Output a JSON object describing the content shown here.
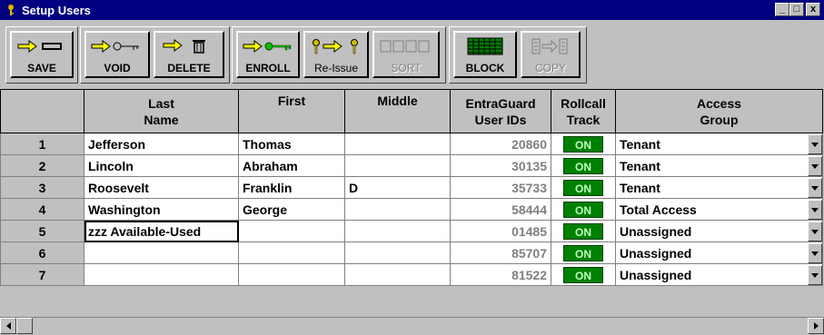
{
  "window": {
    "title": "Setup Users",
    "minimize": "_",
    "maximize": "□",
    "close": "x"
  },
  "toolbar": {
    "save": {
      "label": "SAVE",
      "icon": "save-icon"
    },
    "void": {
      "label": "VOID",
      "icon": "void-key-icon"
    },
    "delete": {
      "label": "DELETE",
      "icon": "trash-icon"
    },
    "enroll": {
      "label": "ENROLL",
      "icon": "enroll-key-icon"
    },
    "reissue": {
      "label": "Re-Issue",
      "icon": "reissue-icon"
    },
    "sort": {
      "label": "SORT",
      "icon": "sort-icon",
      "disabled": true
    },
    "block": {
      "label": "BLOCK",
      "icon": "block-grid-icon"
    },
    "copy": {
      "label": "COPY",
      "icon": "copy-icon",
      "disabled": true
    }
  },
  "columns": {
    "last": [
      "Last",
      "Name"
    ],
    "first": [
      "First",
      ""
    ],
    "middle": [
      "Middle",
      ""
    ],
    "userid": [
      "EntraGuard",
      "User IDs"
    ],
    "rollcall": [
      "Rollcall",
      "Track"
    ],
    "access": [
      "Access",
      "Group"
    ]
  },
  "rows": [
    {
      "n": "1",
      "last": "Jefferson",
      "first": "Thomas",
      "middle": "",
      "id": "20860",
      "track": "ON",
      "group": "Tenant"
    },
    {
      "n": "2",
      "last": "Lincoln",
      "first": "Abraham",
      "middle": "",
      "id": "30135",
      "track": "ON",
      "group": "Tenant"
    },
    {
      "n": "3",
      "last": "Roosevelt",
      "first": "Franklin",
      "middle": "D",
      "id": "35733",
      "track": "ON",
      "group": "Tenant"
    },
    {
      "n": "4",
      "last": "Washington",
      "first": "George",
      "middle": "",
      "id": "58444",
      "track": "ON",
      "group": "Total Access"
    },
    {
      "n": "5",
      "last": "zzz Available-Used",
      "first": "",
      "middle": "",
      "id": "01485",
      "track": "ON",
      "group": "Unassigned"
    },
    {
      "n": "6",
      "last": "",
      "first": "",
      "middle": "",
      "id": "85707",
      "track": "ON",
      "group": "Unassigned"
    },
    {
      "n": "7",
      "last": "",
      "first": "",
      "middle": "",
      "id": "81522",
      "track": "ON",
      "group": "Unassigned"
    }
  ],
  "colors": {
    "titlebar": "#000080",
    "on_badge": "#008000",
    "face": "#c0c0c0"
  }
}
